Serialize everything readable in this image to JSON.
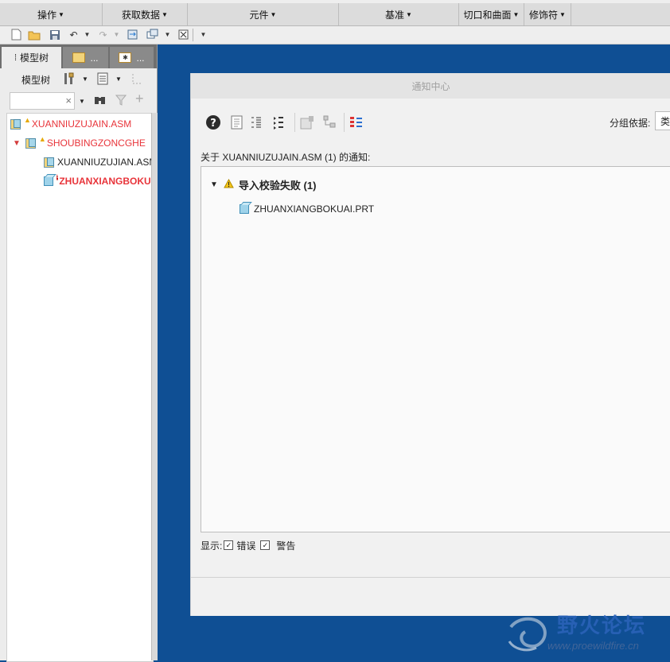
{
  "ribbon": {
    "groups": [
      "操作",
      "获取数据",
      "元件",
      "基准",
      "切口和曲面",
      "修饰符"
    ]
  },
  "left_panel": {
    "tabs": {
      "model_tree": "模型树",
      "tab2": "...",
      "tab3": "..."
    },
    "toolbar_label": "模型树",
    "search": {
      "value": "",
      "clear": "×"
    },
    "tree_items": [
      {
        "label": "XUANNIUZUJAIN.ASM",
        "status": "warning",
        "color": "#e8343a"
      },
      {
        "label": "SHOUBINGZONCGHE",
        "status": "warning",
        "color": "#e8343a",
        "expanded": true
      },
      {
        "label": "XUANNIUZUJIAN.ASM",
        "status": "none",
        "color": "#222222"
      },
      {
        "label": "ZHUANXIANGBOKUAI.PRT",
        "status": "error",
        "color": "#e8343a"
      }
    ]
  },
  "dialog": {
    "title": "通知中心",
    "group_by_label": "分组依据:",
    "group_by_value": "类",
    "heading": "关于 XUANNIUZUJAIN.ASM (1) 的通知:",
    "group": {
      "label": "导入校验失败 (1)",
      "expanded_icon": "▼"
    },
    "items": [
      "ZHUANXIANGBOKUAI.PRT"
    ],
    "filter": {
      "show_label": "显示:",
      "errors_label": "错误",
      "warnings_label": "警告",
      "errors_checked": true,
      "warnings_checked": true
    }
  },
  "watermark": {
    "title": "野火论坛",
    "url": "www.proewildfire.cn"
  },
  "colors": {
    "background": "#0f4f94",
    "error_text": "#e8343a",
    "warning": "#e6a800"
  }
}
